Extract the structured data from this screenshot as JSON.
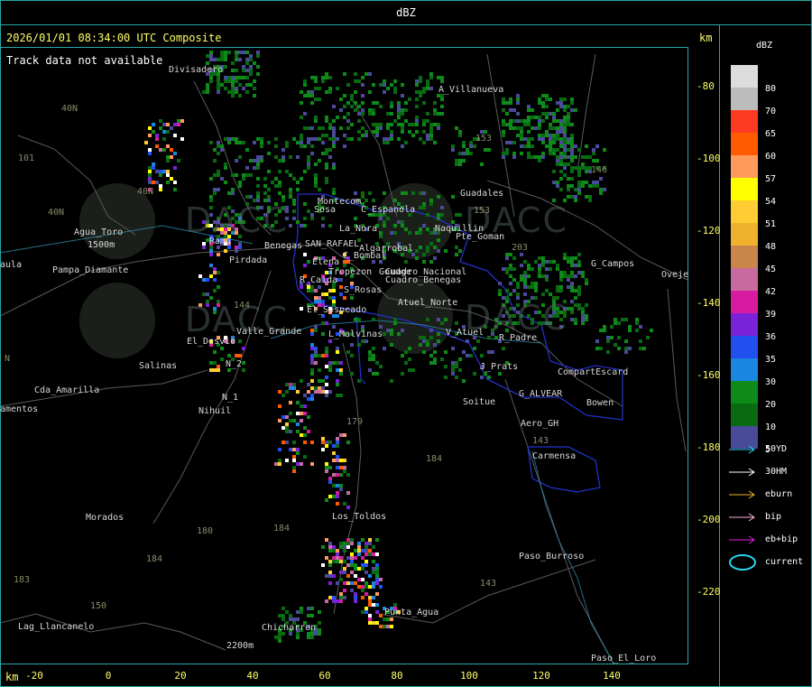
{
  "header": {
    "title": "dBZ"
  },
  "plot": {
    "timestamp": "2026/01/01 08:34:00 UTC Composite",
    "track_status": "Track data not available",
    "km_label_right": "km",
    "km_label_bottom": "km",
    "y_ticks": [
      "-80",
      "-100",
      "-120",
      "-140",
      "-160",
      "-180",
      "-200",
      "-220"
    ],
    "x_ticks": [
      "-20",
      "0",
      "20",
      "40",
      "60",
      "80",
      "100",
      "120",
      "140"
    ]
  },
  "legend": {
    "title": "dBZ",
    "levels": [
      {
        "label": "80",
        "color": "#dcdcdc"
      },
      {
        "label": "70",
        "color": "#bcbcbc"
      },
      {
        "label": "65",
        "color": "#ff3a22"
      },
      {
        "label": "60",
        "color": "#ff5a00"
      },
      {
        "label": "57",
        "color": "#ff9a5a"
      },
      {
        "label": "54",
        "color": "#ffff00"
      },
      {
        "label": "51",
        "color": "#ffcc33"
      },
      {
        "label": "48",
        "color": "#f0b22c"
      },
      {
        "label": "45",
        "color": "#c8864a"
      },
      {
        "label": "42",
        "color": "#c86aa0"
      },
      {
        "label": "39",
        "color": "#d81aa0"
      },
      {
        "label": "36",
        "color": "#7a22d8"
      },
      {
        "label": "35",
        "color": "#2250f0"
      },
      {
        "label": "30",
        "color": "#1a86e0"
      },
      {
        "label": "20",
        "color": "#0e8a1a"
      },
      {
        "label": "10",
        "color": "#0a6a12"
      },
      {
        "label": "5",
        "color": "#4a4a9a"
      }
    ],
    "tracks": [
      {
        "label": "50YD",
        "color": "#2ad4f0"
      },
      {
        "label": "30HM",
        "color": "#ffffff"
      },
      {
        "label": "eburn",
        "color": "#f0b22c"
      },
      {
        "label": "bip",
        "color": "#ffb0d8"
      },
      {
        "label": "eb+bip",
        "color": "#e020e0"
      }
    ],
    "current_label": "current",
    "current_color": "#2ad4f0"
  },
  "map": {
    "places": [
      "Divisadero",
      "A_Villanueva",
      "Guadales",
      "Montecom",
      "Sosa",
      "Agua_Toro",
      "1500m",
      "Pampa_Diamante",
      "aula",
      "Rama",
      "Pirdada",
      "Benegas",
      "SAN_RAFAEL",
      "Algarrobal",
      "C_Espanola",
      "Cuadro_Nacional",
      "Cuadro_Benegas",
      "La_Nora",
      "C_Bombal",
      "Elena",
      "Naquillin",
      "Pte_Goman",
      "G_Campos",
      "Oveje",
      "R_Caida",
      "Tropezon",
      "Goudge",
      "S_Rosas",
      "Atuel_Norte",
      "El_Sosneado",
      "El_Desvio",
      "Valle_Grande",
      "L_Malvinas",
      "V_Atuel",
      "R_Padre",
      "Salinas",
      "N_2",
      "Cda_Amarilla",
      "amentos",
      "N_1",
      "Nihuil",
      "J_Prats",
      "CompartEscard",
      "G_ALVEAR",
      "Soitue",
      "Bowen",
      "Aero_GH",
      "Carmensa",
      "Morados",
      "Los_Toldos",
      "Paso_Burroso",
      "Punta_Agua",
      "Lag_Llancanelo",
      "2200m",
      "Paso_El_Loro",
      "Chicharron"
    ],
    "routes": [
      "40N",
      "101",
      "40N",
      "40N",
      "153",
      "146",
      "153",
      "203",
      "144",
      "179",
      "184",
      "180",
      "184",
      "184",
      "183",
      "150",
      "143",
      "143",
      "N"
    ]
  }
}
